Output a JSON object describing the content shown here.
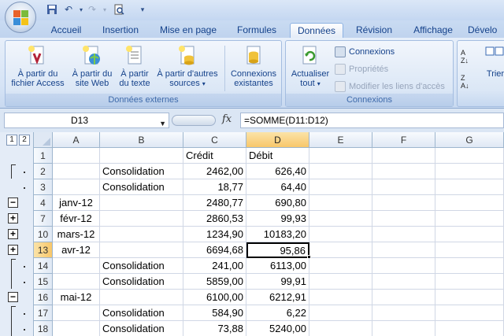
{
  "quick_access": [
    "save-icon",
    "undo-icon",
    "redo-icon",
    "print-preview-icon",
    "customize-icon"
  ],
  "tabs": [
    {
      "label": "Accueil"
    },
    {
      "label": "Insertion"
    },
    {
      "label": "Mise en page"
    },
    {
      "label": "Formules"
    },
    {
      "label": "Données",
      "active": true
    },
    {
      "label": "Révision"
    },
    {
      "label": "Affichage"
    },
    {
      "label": "Dévelo"
    }
  ],
  "ribbon": {
    "external_group_label": "Données externes",
    "connections_group_label": "Connexions",
    "btn_access": "À partir du fichier Access",
    "btn_access_l1": "À partir du",
    "btn_access_l2": "fichier Access",
    "btn_web_l1": "À partir du",
    "btn_web_l2": "site Web",
    "btn_text_l1": "À partir",
    "btn_text_l2": "du texte",
    "btn_other_l1": "À partir d'autres",
    "btn_other_l2": "sources",
    "btn_existing_l1": "Connexions",
    "btn_existing_l2": "existantes",
    "btn_refresh_l1": "Actualiser",
    "btn_refresh_l2": "tout",
    "btn_connections": "Connexions",
    "btn_properties": "Propriétés",
    "btn_edit_links": "Modifier les liens d'accès",
    "btn_sort": "Trier"
  },
  "formula_bar": {
    "name_box": "D13",
    "fx": "fx",
    "formula": "=SOMME(D11:D12)"
  },
  "outline_levels": [
    "1",
    "2"
  ],
  "columns": [
    "A",
    "B",
    "C",
    "D",
    "E",
    "F",
    "G"
  ],
  "rows": [
    {
      "num": "1",
      "a": "",
      "b": "",
      "c": "Crédit",
      "d": "Débit"
    },
    {
      "num": "2",
      "a": "",
      "b": "Consolidation",
      "c": "2462,00",
      "d": "626,40"
    },
    {
      "num": "3",
      "a": "",
      "b": "Consolidation",
      "c": "18,77",
      "d": "64,40"
    },
    {
      "num": "4",
      "a": "janv-12",
      "b": "",
      "c": "2480,77",
      "d": "690,80"
    },
    {
      "num": "7",
      "a": "févr-12",
      "b": "",
      "c": "2860,53",
      "d": "99,93"
    },
    {
      "num": "10",
      "a": "mars-12",
      "b": "",
      "c": "1234,90",
      "d": "10183,20"
    },
    {
      "num": "13",
      "a": "avr-12",
      "b": "",
      "c": "6694,68",
      "d": "95,86"
    },
    {
      "num": "14",
      "a": "",
      "b": "Consolidation",
      "c": "241,00",
      "d": "6113,00"
    },
    {
      "num": "15",
      "a": "",
      "b": "Consolidation",
      "c": "5859,00",
      "d": "99,91"
    },
    {
      "num": "16",
      "a": "mai-12",
      "b": "",
      "c": "6100,00",
      "d": "6212,91"
    },
    {
      "num": "17",
      "a": "",
      "b": "Consolidation",
      "c": "584,90",
      "d": "6,22"
    },
    {
      "num": "18",
      "a": "",
      "b": "Consolidation",
      "c": "73,88",
      "d": "5240,00"
    }
  ],
  "outline_buttons": {
    "minus": "−",
    "plus": "+"
  },
  "colors": {
    "selected_header": "#f8c76a",
    "ribbon_text": "#15428b"
  }
}
